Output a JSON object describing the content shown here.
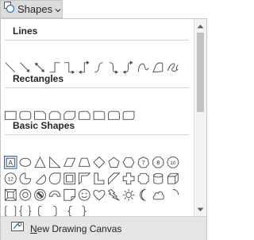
{
  "button": {
    "label": "Shapes",
    "icon": "shapes-icon"
  },
  "sections": [
    {
      "title": "Lines",
      "shapes": [
        "line",
        "line-arrow",
        "line-double-arrow",
        "elbow-connector",
        "elbow-arrow",
        "elbow-double-arrow",
        "curved-connector",
        "curved-arrow",
        "curved-double-arrow",
        "curve",
        "freeform",
        "scribble"
      ]
    },
    {
      "title": "Rectangles",
      "shapes": [
        "rectangle",
        "rounded-rectangle",
        "snip-single-corner",
        "snip-same-side",
        "snip-diagonal",
        "snip-round-corner",
        "round-single-corner",
        "round-same-side",
        "round-diagonal"
      ]
    },
    {
      "title": "Basic Shapes",
      "shapes": [
        "text-box",
        "oval",
        "isosceles-triangle",
        "right-triangle",
        "parallelogram",
        "trapezoid",
        "diamond",
        "pentagon",
        "hexagon",
        "heptagon",
        "octagon",
        "decagon",
        "dodecagon",
        "pie",
        "chord",
        "teardrop",
        "frame",
        "half-frame",
        "l-shape",
        "diagonal-stripe",
        "cross",
        "plaque",
        "can",
        "cube",
        "bevel",
        "donut",
        "no-symbol",
        "block-arc",
        "folded-corner",
        "smiley-face",
        "heart",
        "lightning-bolt",
        "sun",
        "moon",
        "cloud",
        "arc",
        "double-bracket",
        "double-brace",
        "left-bracket",
        "right-bracket",
        "left-brace",
        "right-brace"
      ]
    }
  ],
  "footer": {
    "label": "New Drawing Canvas",
    "mnemonic": "N",
    "rest": "ew Drawing Canvas",
    "icon": "drawing-canvas-icon"
  },
  "colors": {
    "selection": "#2b579a",
    "button_bg": "#dcdcdc",
    "footer_bg": "#e5e5e5"
  }
}
